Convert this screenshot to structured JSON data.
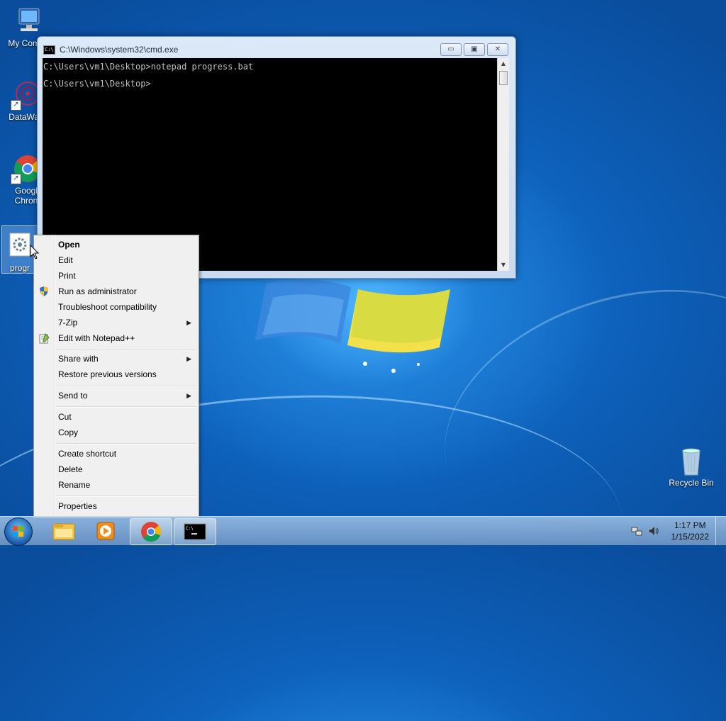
{
  "desktop": {
    "icons": [
      {
        "label": "My Comp",
        "icon": "computer-icon"
      },
      {
        "label": "DataWag",
        "icon": "datawag-icon"
      },
      {
        "label": "Googl\nChron",
        "line1": "Googl",
        "line2": "Chron",
        "icon": "chrome-icon"
      },
      {
        "label": "progr",
        "icon": "batch-file-icon"
      },
      {
        "label": "Recycle Bin",
        "icon": "recycle-bin-icon"
      }
    ]
  },
  "cmd_window": {
    "title": "C:\\Windows\\system32\\cmd.exe",
    "lines": [
      "C:\\Users\\vm1\\Desktop>notepad progress.bat",
      "C:\\Users\\vm1\\Desktop>"
    ],
    "buttons": {
      "minimize": "▭",
      "maximize": "▣",
      "close": "✕"
    }
  },
  "context_menu": {
    "items": [
      {
        "label": "Open",
        "bold": true
      },
      {
        "label": "Edit"
      },
      {
        "label": "Print"
      },
      {
        "label": "Run as administrator",
        "icon": "shield-icon"
      },
      {
        "label": "Troubleshoot compatibility"
      },
      {
        "label": "7-Zip",
        "submenu": true
      },
      {
        "label": "Edit with Notepad++",
        "icon": "notepad-plus-plus-icon"
      },
      {
        "label": "Share with",
        "submenu": true
      },
      {
        "label": "Restore previous versions"
      },
      {
        "label": "Send to",
        "submenu": true
      },
      {
        "label": "Cut"
      },
      {
        "label": "Copy"
      },
      {
        "label": "Create shortcut"
      },
      {
        "label": "Delete"
      },
      {
        "label": "Rename"
      },
      {
        "label": "Properties"
      }
    ],
    "submenu_arrow": "▶"
  },
  "taskbar": {
    "pinned": [
      "explorer-icon",
      "media-player-icon",
      "chrome-icon",
      "cmd-icon"
    ],
    "clock": {
      "time": "1:17 PM",
      "date": "1/15/2022"
    }
  }
}
